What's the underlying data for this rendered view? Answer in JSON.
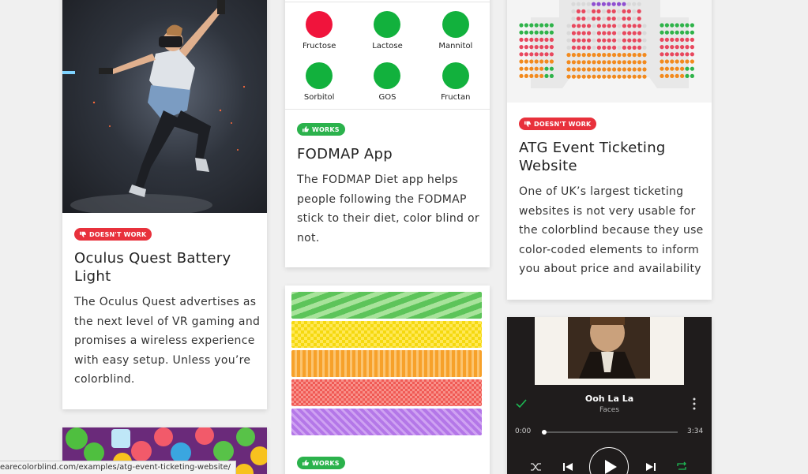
{
  "cards": {
    "oculus": {
      "badge": "DOESN'T WORK",
      "title": "Oculus Quest Battery Light",
      "text": "The Oculus Quest advertises as the next level of VR gaming and promises a wireless experience with easy setup. Unless you’re colorblind."
    },
    "fodmap": {
      "items": [
        {
          "label": "Fructose",
          "color": "#f0143c"
        },
        {
          "label": "Lactose",
          "color": "#12b13d"
        },
        {
          "label": "Mannitol",
          "color": "#12b13d"
        },
        {
          "label": "Sorbitol",
          "color": "#12b13d"
        },
        {
          "label": "GOS",
          "color": "#12b13d"
        },
        {
          "label": "Fructan",
          "color": "#12b13d"
        }
      ],
      "badge": "WORKS",
      "title": "FODMAP App",
      "text": "The FODMAP Diet app helps people following the FODMAP stick to their diet, color blind or not."
    },
    "atg": {
      "badge": "DOESN'T WORK",
      "title": "ATG Event Ticketing Website",
      "text": "One of UK’s largest ticketing websites is not very usable for the colorblind because they use color-coded elements to inform you about price and availability"
    },
    "pattern": {
      "badge": "WORKS"
    },
    "spotify": {
      "track_title": "Ooh La La",
      "artist": "Faces",
      "time_elapsed": "0:00",
      "time_total": "3:34",
      "progress": 0
    }
  },
  "status_url": "earecolorblind.com/examples/atg-event-ticketing-website/",
  "colors": {
    "bad": "#e8313c",
    "good": "#2bb24c",
    "spotify_green": "#1db954"
  }
}
